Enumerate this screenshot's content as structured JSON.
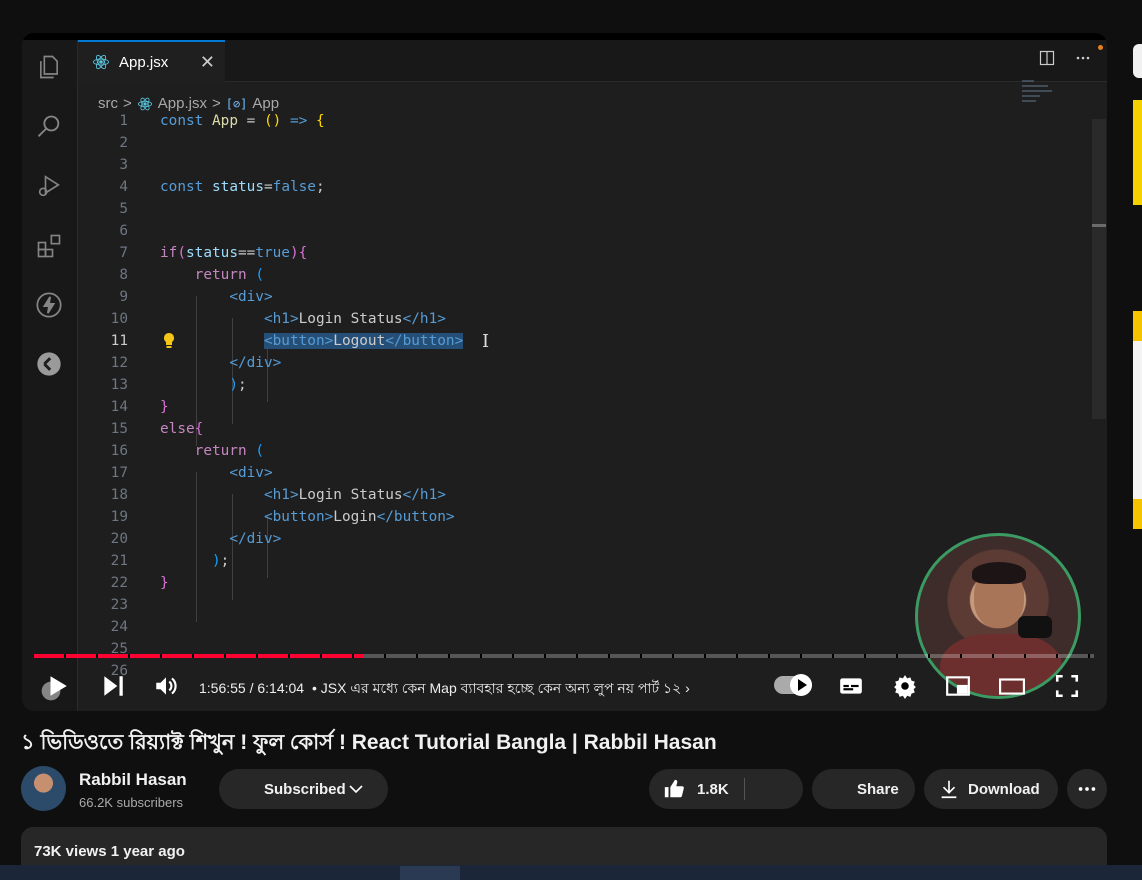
{
  "video": {
    "tab": {
      "filename": "App.jsx",
      "close": "✕"
    },
    "breadcrumb": {
      "folder": "src",
      "sep": ">",
      "file": "App.jsx",
      "symbol_glyph": "[⊘]",
      "symbol": "App"
    },
    "code_lines": [
      "1",
      "2",
      "3",
      "4",
      "5",
      "6",
      "7",
      "8",
      "9",
      "10",
      "11",
      "12",
      "13",
      "14",
      "15",
      "16",
      "17",
      "18",
      "19",
      "20",
      "21",
      "22",
      "23",
      "24",
      "25",
      "26"
    ],
    "player": {
      "time": "1:56:55 / 6:14:04",
      "chapter": "• JSX এর মধ্যে কেন Map ব্যাবহার হচ্ছে কেন অন্য লুপ নয় পার্ট ১২",
      "chapter_arrow": "›"
    }
  },
  "title": "১ ভিডিওতে রিয়্যাক্ট শিখুন ! ফুল কোর্স ! React Tutorial Bangla | Rabbil Hasan",
  "channel": {
    "name": "Rabbil Hasan",
    "subscribers": "66.2K subscribers"
  },
  "actions": {
    "subscribed": "Subscribed",
    "likes": "1.8K",
    "share": "Share",
    "download": "Download"
  },
  "description": {
    "stats": "73K views  1 year ago"
  },
  "colors": {
    "accent_red": "#ff0033",
    "vscode_blue": "#0078d4",
    "bg": "#0f0f0f"
  }
}
